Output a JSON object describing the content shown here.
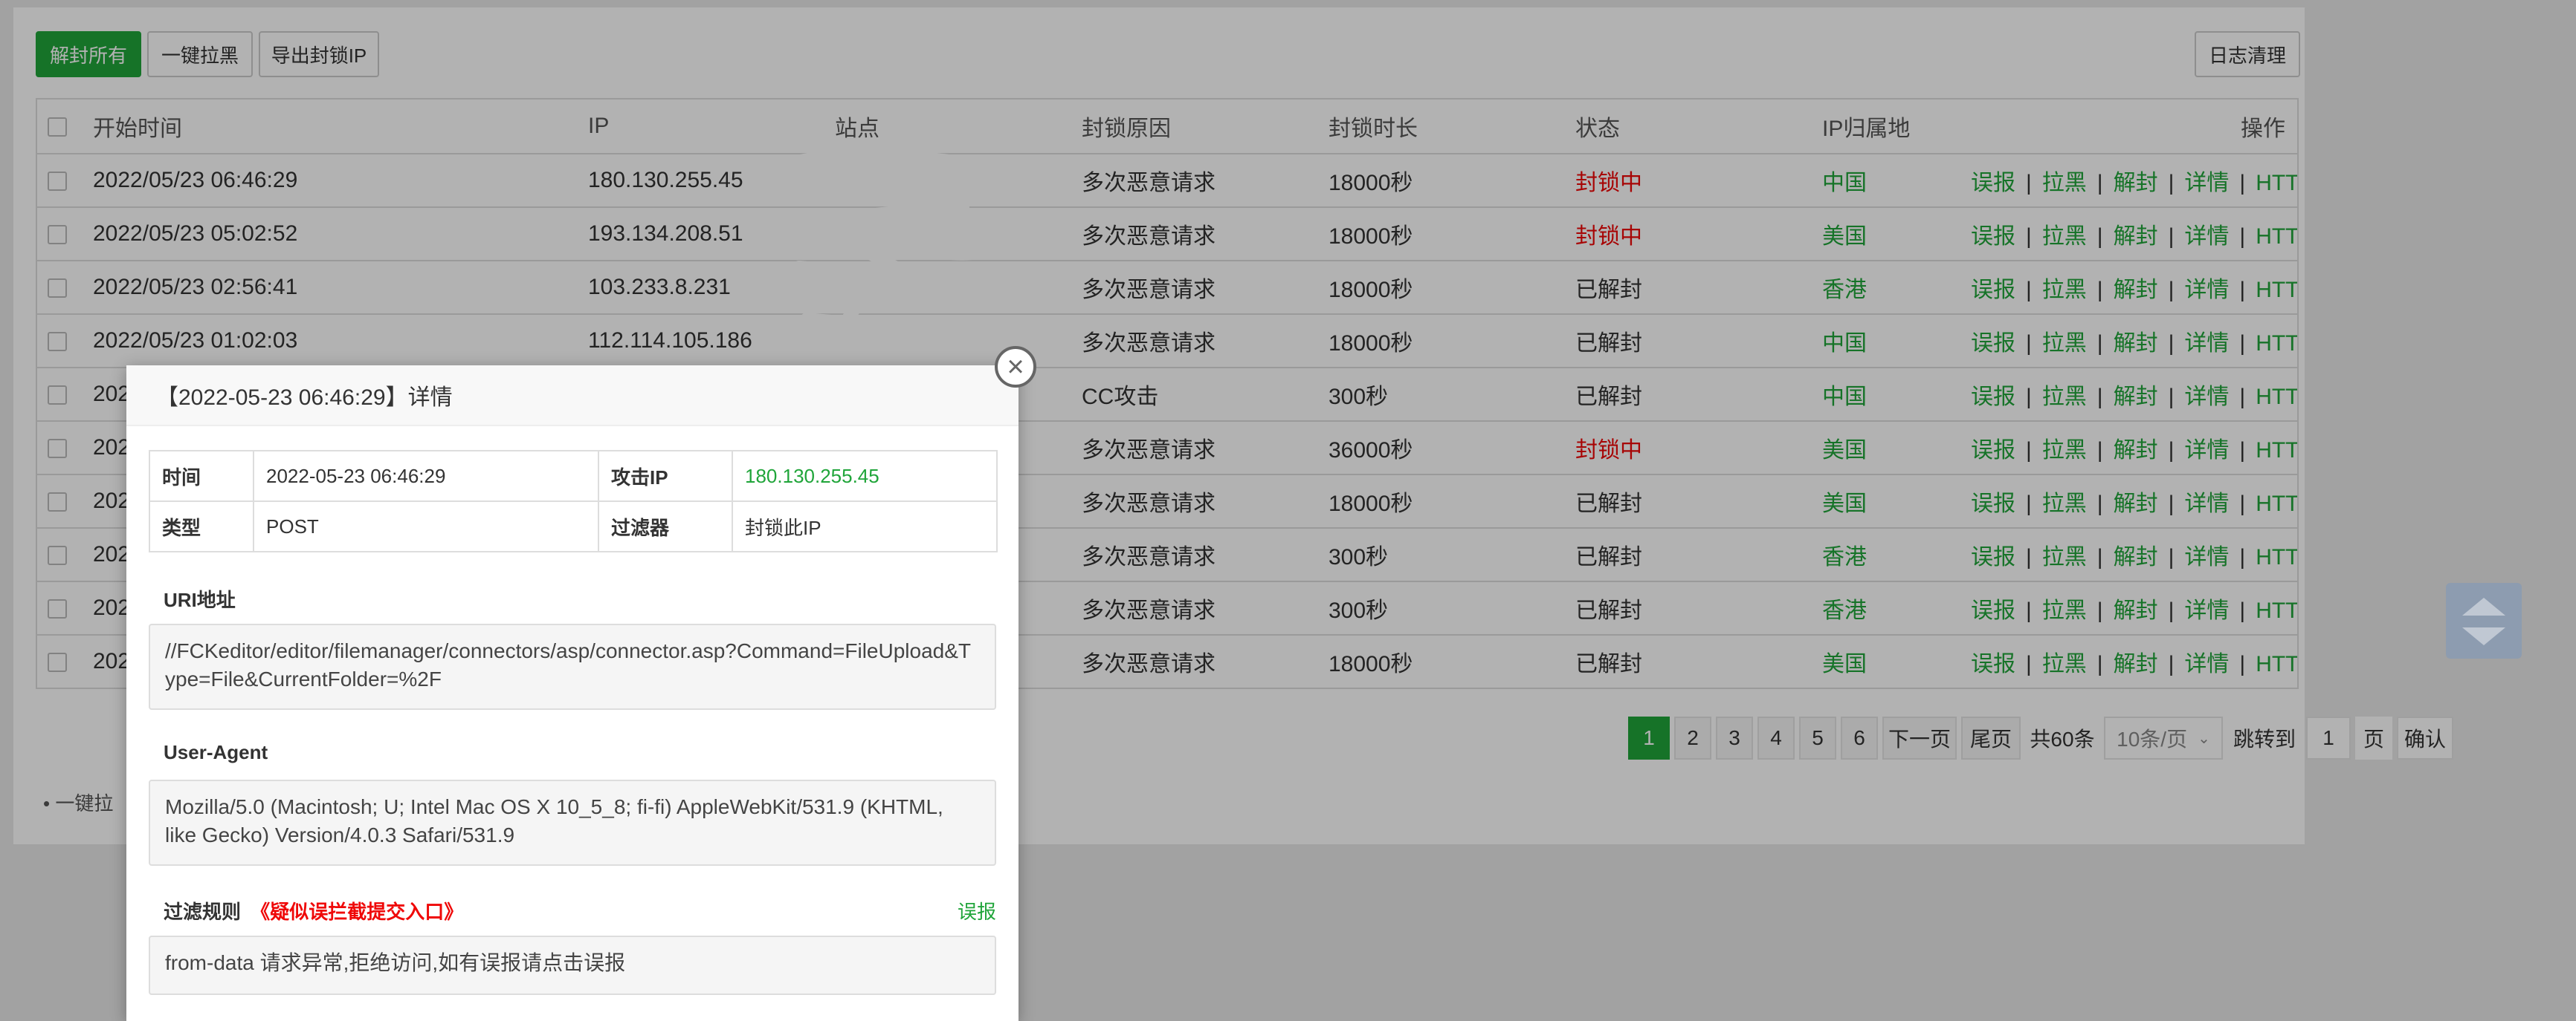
{
  "toolbar": {
    "unblock_all": "解封所有",
    "blacklist_all": "一键拉黑",
    "export_ip": "导出封锁IP",
    "clear_log": "日志清理"
  },
  "table": {
    "headers": {
      "start_time": "开始时间",
      "ip": "IP",
      "site": "站点",
      "reason": "封锁原因",
      "duration": "封锁时长",
      "status": "状态",
      "location": "IP归属地",
      "ops": "操作"
    },
    "rows": [
      {
        "time": "2022/05/23 06:46:29",
        "ip": "180.130.255.45",
        "reason": "多次恶意请求",
        "duration": "18000秒",
        "status": "封锁中",
        "location": "中国"
      },
      {
        "time": "2022/05/23 05:02:52",
        "ip": "193.134.208.51",
        "reason": "多次恶意请求",
        "duration": "18000秒",
        "status": "封锁中",
        "location": "美国"
      },
      {
        "time": "2022/05/23 02:56:41",
        "ip": "103.233.8.231",
        "reason": "多次恶意请求",
        "duration": "18000秒",
        "status": "已解封",
        "location": "香港"
      },
      {
        "time": "2022/05/23 01:02:03",
        "ip": "112.114.105.186",
        "reason": "多次恶意请求",
        "duration": "18000秒",
        "status": "已解封",
        "location": "中国"
      },
      {
        "time": "202",
        "ip": "",
        "reason": "CC攻击",
        "duration": "300秒",
        "status": "已解封",
        "location": "中国"
      },
      {
        "time": "202",
        "ip": "",
        "reason": "多次恶意请求",
        "duration": "36000秒",
        "status": "封锁中",
        "location": "美国"
      },
      {
        "time": "202",
        "ip": "",
        "reason": "多次恶意请求",
        "duration": "18000秒",
        "status": "已解封",
        "location": "美国"
      },
      {
        "time": "202",
        "ip": "",
        "reason": "多次恶意请求",
        "duration": "300秒",
        "status": "已解封",
        "location": "香港"
      },
      {
        "time": "202",
        "ip": "",
        "reason": "多次恶意请求",
        "duration": "300秒",
        "status": "已解封",
        "location": "香港"
      },
      {
        "time": "202",
        "ip": "",
        "reason": "多次恶意请求",
        "duration": "18000秒",
        "status": "已解封",
        "location": "美国"
      }
    ],
    "ops": [
      "误报",
      "拉黑",
      "解封",
      "详情",
      "HTTP"
    ],
    "separator": "|"
  },
  "pagination": {
    "pages": [
      "1",
      "2",
      "3",
      "4",
      "5",
      "6"
    ],
    "next": "下一页",
    "last": "尾页",
    "total": "共60条",
    "page_size": "10条/页",
    "goto_label": "跳转到",
    "goto_value": "1",
    "page_unit": "页",
    "confirm": "确认"
  },
  "footer_note": "• 一键拉",
  "modal": {
    "title": "【2022-05-23 06:46:29】详情",
    "time_label": "时间",
    "time_value": "2022-05-23 06:46:29",
    "ip_label": "攻击IP",
    "ip_value": "180.130.255.45",
    "type_label": "类型",
    "type_value": "POST",
    "filter_label": "过滤器",
    "filter_value": "封锁此IP",
    "uri_label": "URI地址",
    "uri_value": "//FCKeditor/editor/filemanager/connectors/asp/connector.asp?Command=FileUpload&Type=File&CurrentFolder=%2F",
    "ua_label": "User-Agent",
    "ua_value": "Mozilla/5.0 (Macintosh; U; Intel Mac OS X 10_5_8; fi-fi) AppleWebKit/531.9 (KHTML, like Gecko) Version/4.0.3 Safari/531.9",
    "rule_label": "过滤规则",
    "rule_name": "《疑似误拦截提交入口》",
    "report": "误报",
    "rule_value": "from-data 请求异常,拒绝访问,如有误报请点击误报"
  },
  "colors": {
    "accent": "#20a53a",
    "danger": "#ef0808"
  }
}
